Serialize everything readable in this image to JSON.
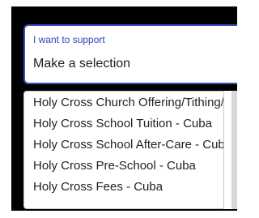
{
  "dropdown": {
    "label": "I want to support",
    "value": "Make a selection",
    "options": [
      "Holy Cross Church Offering/Tithing/Do",
      "Holy Cross School Tuition - Cuba",
      "Holy Cross School After-Care - Cuba",
      "Holy Cross Pre-School - Cuba",
      "Holy Cross Fees - Cuba"
    ]
  },
  "colors": {
    "accent": "#3b4dbf",
    "label": "#2f43b8",
    "text": "#1f1f1f",
    "frame": "#000000"
  }
}
